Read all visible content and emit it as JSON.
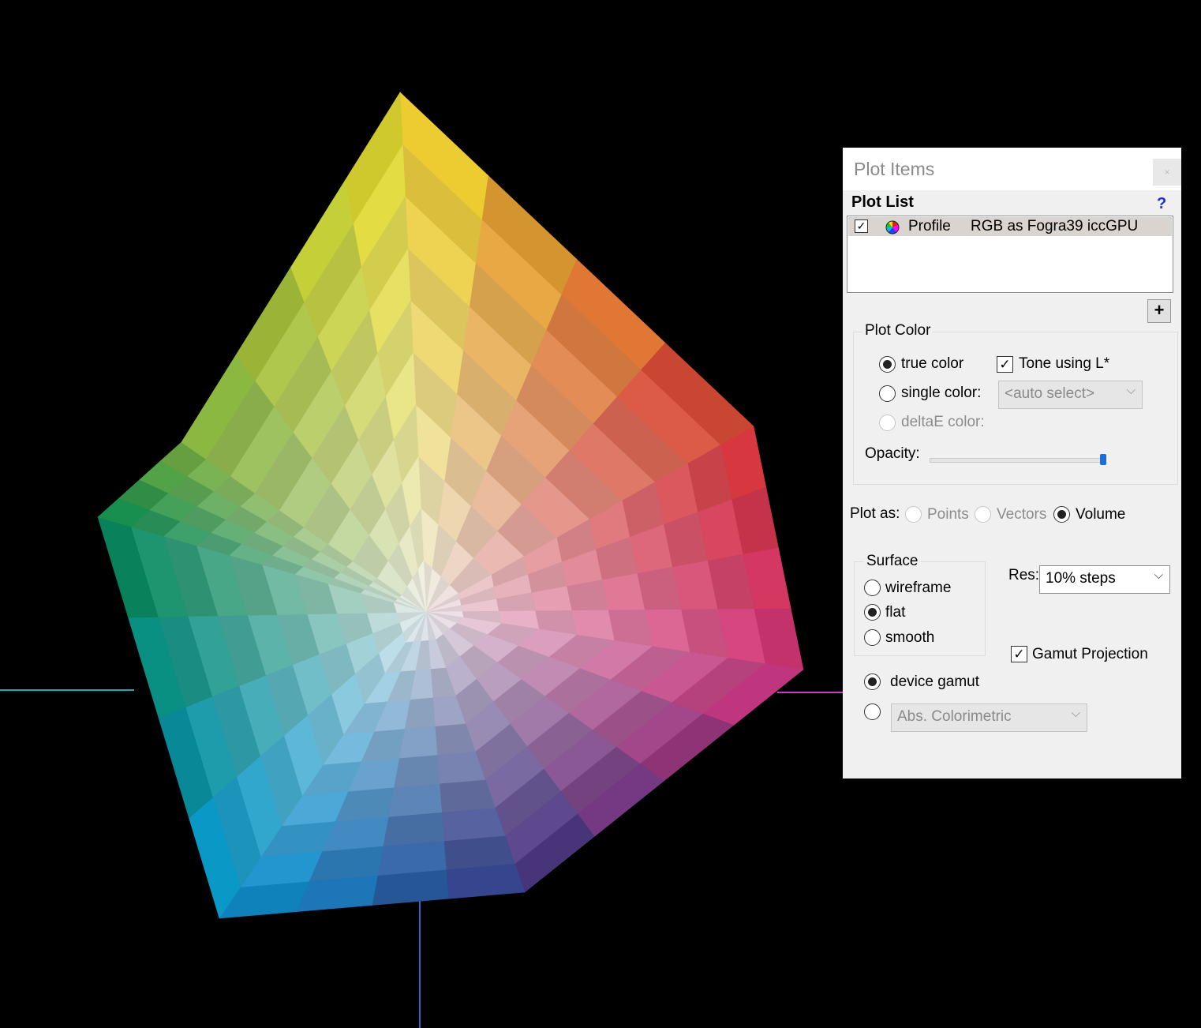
{
  "viewer": {
    "axis_colors": {
      "neg_a": "#1fa8b8",
      "pos_a": "#c83cc8",
      "neg_b": "#2a6cc0"
    }
  },
  "panel": {
    "title": "Plot Items",
    "close_label": "×",
    "plot_list": {
      "label": "Plot List",
      "help": "?",
      "rows": [
        {
          "checked": true,
          "checkmark": "✓",
          "type": "Profile",
          "name": "RGB as Fogra39 iccGPU"
        }
      ],
      "add_label": "+"
    },
    "plot_color": {
      "label": "Plot Color",
      "true_color": "true color",
      "single_color": "single color:",
      "single_color_value": "<auto select>",
      "deltae_color": "deltaE color:",
      "tone_using_l": "Tone using L*",
      "tone_checkmark": "✓",
      "opacity_label": "Opacity:",
      "opacity": 1.0
    },
    "plot_as": {
      "label": "Plot as:",
      "points": "Points",
      "vectors": "Vectors",
      "volume": "Volume"
    },
    "surface": {
      "label": "Surface",
      "wireframe": "wireframe",
      "flat": "flat",
      "smooth": "smooth"
    },
    "res": {
      "label": "Res:",
      "value": "10% steps"
    },
    "gamut_projection": {
      "label": "Gamut Projection",
      "checkmark": "✓"
    },
    "device_gamut": "device gamut",
    "intent_value": "Abs. Colorimetric",
    "arrow_glyph": "⌵"
  }
}
